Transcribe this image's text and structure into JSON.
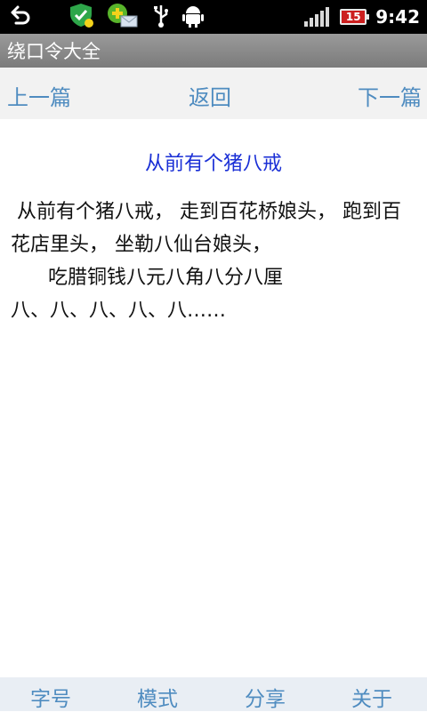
{
  "status_bar": {
    "clock": "9:42",
    "battery_level": "15",
    "icons": [
      "back-arrow-icon",
      "security-shield-icon",
      "message-icon",
      "usb-icon",
      "android-debug-icon",
      "signal-icon",
      "battery-icon"
    ],
    "colors": {
      "background": "#000000",
      "battery": "#cc1f1f"
    }
  },
  "app": {
    "title": "绕口令大全"
  },
  "nav": {
    "prev_label": "上一篇",
    "back_label": "返回",
    "next_label": "下一篇"
  },
  "article": {
    "title": "从前有个猪八戒",
    "lines": [
      " 从前有个猪八戒， 走到百花桥娘头， 跑到百花店里头， 坐勒八仙台娘头，",
      "      吃腊铜钱八元八角八分八厘",
      "八、八、八、八、八……"
    ]
  },
  "bottom_menu": {
    "font_size": "字号",
    "mode": "模式",
    "share": "分享",
    "about": "关于"
  },
  "colors": {
    "link": "#4f8cc0",
    "title": "#1a2fd6"
  }
}
